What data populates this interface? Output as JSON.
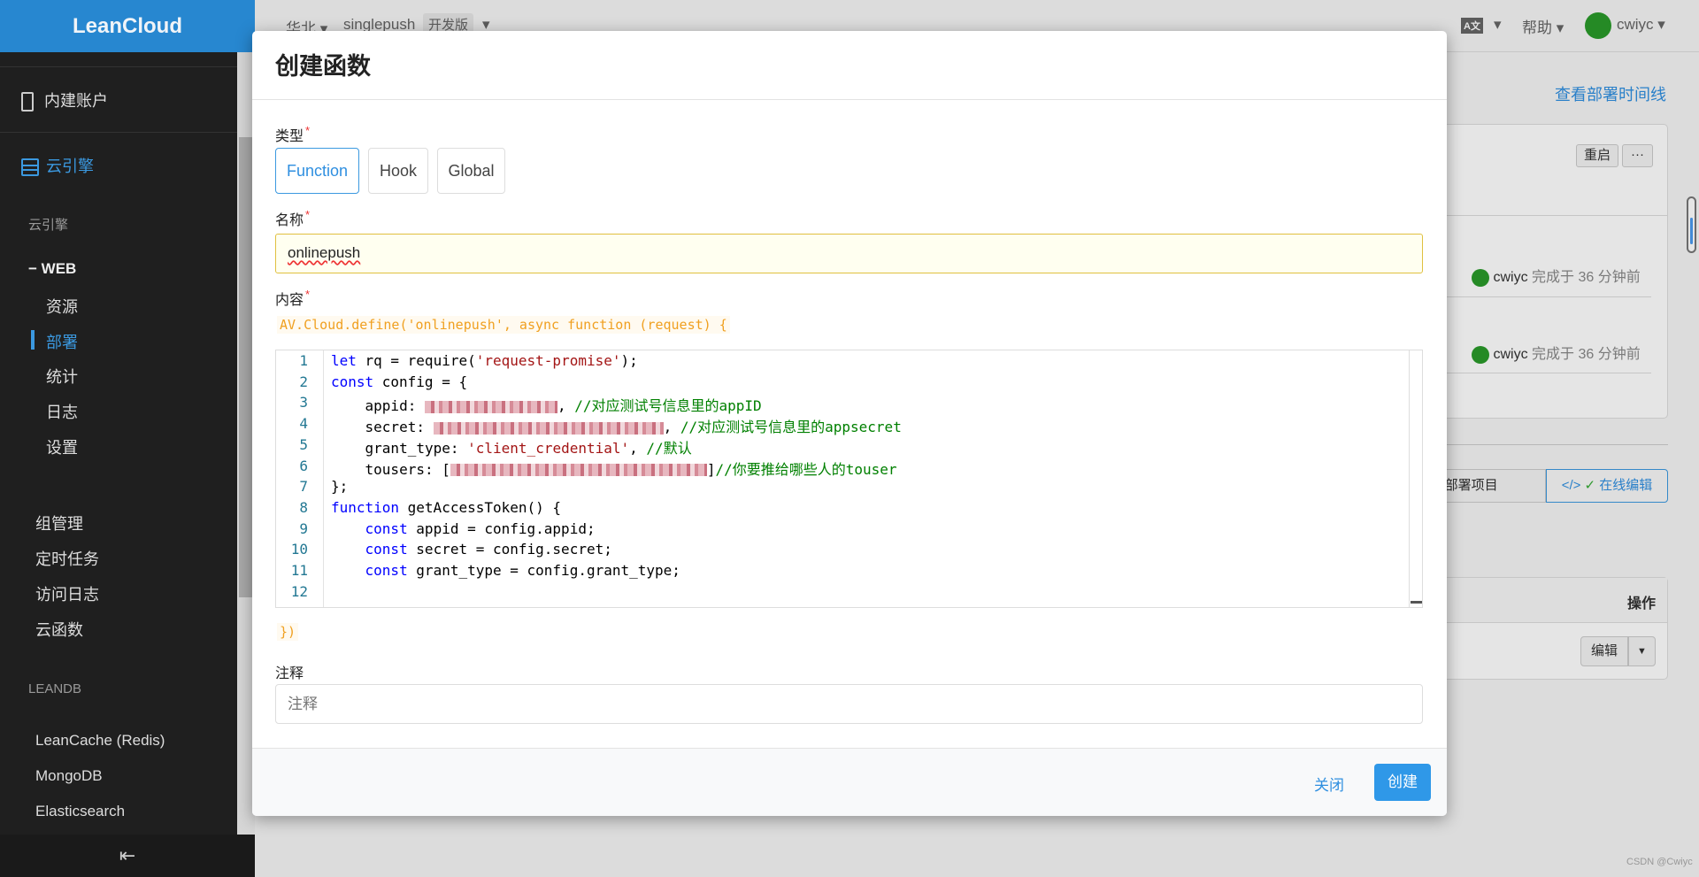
{
  "sidebar": {
    "logo": "LeanCloud",
    "items": [
      {
        "label": "内建账户",
        "icon": "id-card-icon"
      },
      {
        "label": "云引擎",
        "icon": "server-icon",
        "active": true
      }
    ],
    "section_engine": "云引擎",
    "web_group": "− WEB",
    "web_items": [
      "资源",
      "部署",
      "统计",
      "日志",
      "设置"
    ],
    "active_web_item": "部署",
    "other_items": [
      "组管理",
      "定时任务",
      "访问日志",
      "云函数"
    ],
    "section_db": "LEANDB",
    "db_items": [
      "LeanCache (Redis)",
      "MongoDB",
      "Elasticsearch"
    ],
    "collapse_icon": "collapse-left-icon"
  },
  "topbar": {
    "region": "华北",
    "app": "singlepush",
    "plan": "开发版",
    "lang_icon": "language-icon",
    "help": "帮助",
    "user": "cwiyc"
  },
  "background": {
    "timeline_link": "查看部署时间线",
    "restart": "重启",
    "more": "···",
    "deploys": [
      {
        "user": "cwiyc",
        "status": "完成于 36 分钟前"
      },
      {
        "user": "cwiyc",
        "status": "完成于 36 分钟前"
      }
    ],
    "deploy_project": "部署项目",
    "online_edit": "在线编辑",
    "table_header_action": "操作",
    "edit": "编辑",
    "watermark": "CSDN @Cwiyc"
  },
  "modal": {
    "title": "创建函数",
    "type_label": "类型",
    "required": "*",
    "types": [
      "Function",
      "Hook",
      "Global"
    ],
    "selected_type": "Function",
    "name_label": "名称",
    "name_value": "onlinepush",
    "content_label": "内容",
    "code_prefix": "AV.Cloud.define('onlinepush', async function (request) {",
    "code_suffix": "})",
    "code_lines": [
      [
        [
          "kw",
          "let"
        ],
        [
          "",
          "rq = require("
        ],
        [
          "str",
          "'request-promise'"
        ],
        [
          "",
          ");"
        ]
      ],
      [
        [
          "kw",
          "const"
        ],
        [
          "",
          "config = {"
        ]
      ],
      [
        [
          "",
          "    appid: "
        ],
        [
          "blur",
          "150"
        ],
        [
          "",
          ", "
        ],
        [
          "cm",
          "//对应测试号信息里的appID"
        ]
      ],
      [
        [
          "",
          "    secret: "
        ],
        [
          "blur",
          "260"
        ],
        [
          "",
          ", "
        ],
        [
          "cm",
          "//对应测试号信息里的appsecret"
        ]
      ],
      [
        [
          "",
          "    grant_type: "
        ],
        [
          "str",
          "'client_credential'"
        ],
        [
          "",
          ", "
        ],
        [
          "cm",
          "//默认"
        ]
      ],
      [
        [
          "",
          "    tousers: ["
        ],
        [
          "blur",
          "290"
        ],
        [
          "",
          "]"
        ],
        [
          "cm",
          "//你要推给哪些人的touser"
        ]
      ],
      [
        [
          "",
          "};"
        ]
      ],
      [
        [
          "kw",
          "function"
        ],
        [
          "",
          "getAccessToken() {"
        ]
      ],
      [
        [
          "",
          "    "
        ],
        [
          "kw",
          "const"
        ],
        [
          "",
          "appid = config.appid;"
        ]
      ],
      [
        [
          "",
          "    "
        ],
        [
          "kw",
          "const"
        ],
        [
          "",
          "secret = config.secret;"
        ]
      ],
      [
        [
          "",
          "    "
        ],
        [
          "kw",
          "const"
        ],
        [
          "",
          "grant_type = config.grant_type;"
        ]
      ],
      [
        [
          "",
          ""
        ]
      ]
    ],
    "note_label": "注释",
    "note_placeholder": "注释",
    "close": "关闭",
    "create": "创建"
  }
}
